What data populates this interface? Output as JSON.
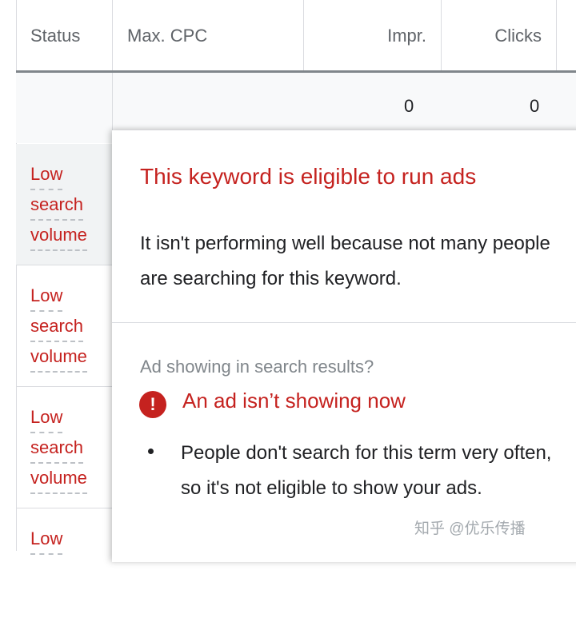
{
  "columns": [
    "Status",
    "Max. CPC",
    "Impr.",
    "Clicks"
  ],
  "totals": {
    "impr": "0",
    "clicks": "0"
  },
  "rows": [
    {
      "status": [
        "Low",
        "search",
        "volume"
      ]
    },
    {
      "status": [
        "Low",
        "search",
        "volume"
      ]
    },
    {
      "status": [
        "Low",
        "search",
        "volume"
      ]
    },
    {
      "status": [
        "Low"
      ]
    }
  ],
  "popup": {
    "title": "This keyword is eligible to run ads",
    "description": "It isn't performing well because not many people are searching for this keyword.",
    "section_label": "Ad showing in search results?",
    "alert_icon": "!",
    "alert_text": "An ad isn’t showing now",
    "bullet": "People don't search for this term very often, so it's not eligible to show your ads."
  },
  "colors": {
    "error": "#c5221f",
    "divider": "#dadce0"
  },
  "icons": {
    "alert": "error-circle-icon"
  },
  "watermark": "知乎 @优乐传播"
}
